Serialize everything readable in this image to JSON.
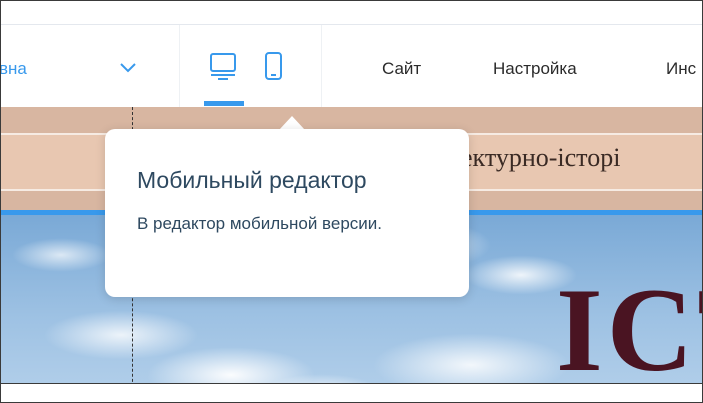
{
  "topbar": {
    "page_selector": {
      "label": "вна"
    },
    "devices": [
      {
        "name": "desktop",
        "active": true
      },
      {
        "name": "mobile",
        "active": false
      }
    ],
    "menu": [
      {
        "label": "Сайт"
      },
      {
        "label": "Настройка"
      },
      {
        "label": "Инс"
      }
    ],
    "accent_color": "#3899ec"
  },
  "canvas": {
    "banner_text": "ектурно-історі",
    "hero_text": "ІСТ"
  },
  "tooltip": {
    "title": "Мобильный редактор",
    "body": "В редактор мобильной версии."
  }
}
